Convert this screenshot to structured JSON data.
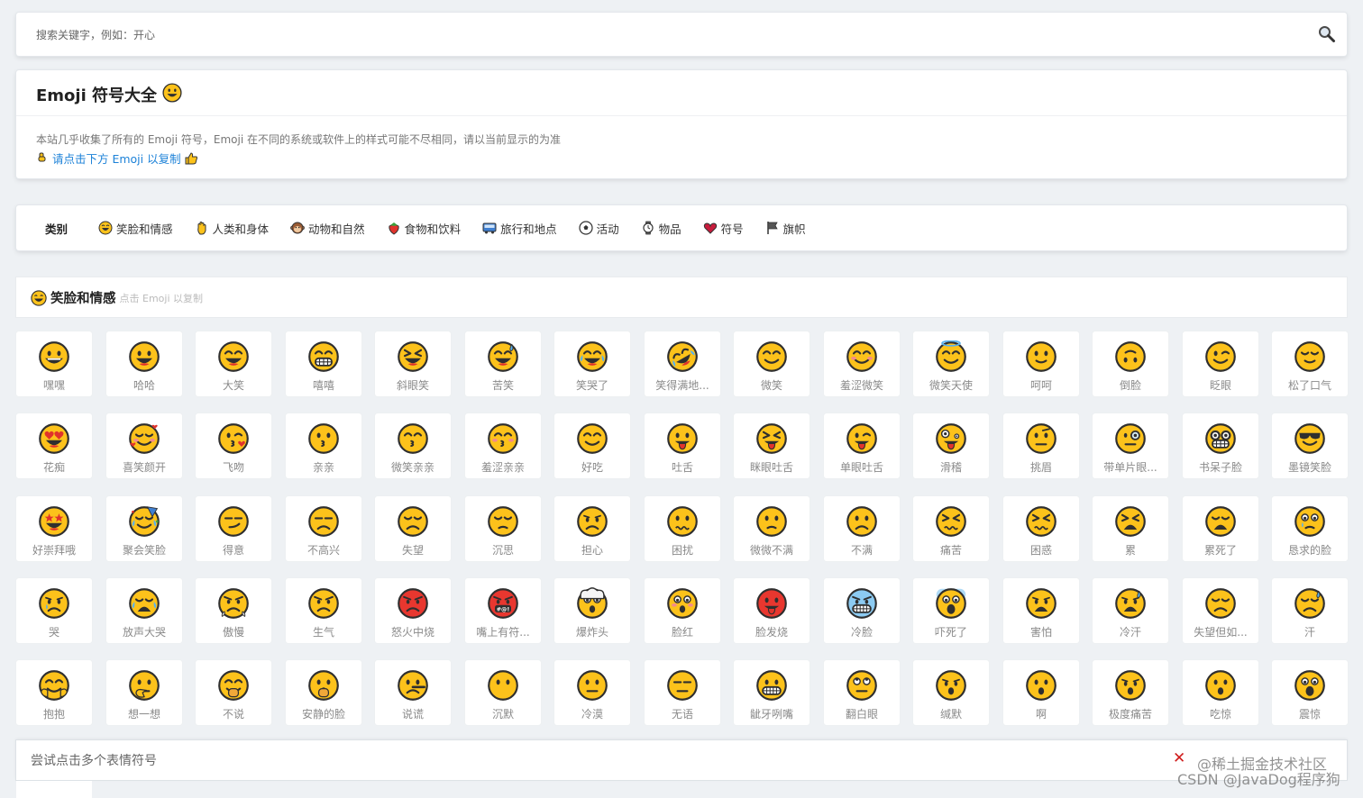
{
  "search": {
    "placeholder": "搜索关键字，例如：开心"
  },
  "header": {
    "title": "Emoji 符号大全",
    "title_emoji": "grinning",
    "description": "本站几乎收集了所有的 Emoji 符号，Emoji 在不同的系统或软件上的样式可能不尽相同，请以当前显示的为准",
    "hint": "请点击下方 Emoji 以复制"
  },
  "categories": {
    "label": "类别",
    "items": [
      {
        "label": "笑脸和情感",
        "icon": "smiley-icon"
      },
      {
        "label": "人类和身体",
        "icon": "hand-icon"
      },
      {
        "label": "动物和自然",
        "icon": "monkey-icon"
      },
      {
        "label": "食物和饮料",
        "icon": "strawberry-icon"
      },
      {
        "label": "旅行和地点",
        "icon": "bus-icon"
      },
      {
        "label": "活动",
        "icon": "soccer-icon"
      },
      {
        "label": "物品",
        "icon": "watch-icon"
      },
      {
        "label": "符号",
        "icon": "heart-icon"
      },
      {
        "label": "旗帜",
        "icon": "flag-icon"
      }
    ]
  },
  "section": {
    "title": "笑脸和情感",
    "subtitle": "点击 Emoji 以复制"
  },
  "emojis": [
    {
      "label": "嘿嘿",
      "f": "grin"
    },
    {
      "label": "哈哈",
      "f": "bigsmile"
    },
    {
      "label": "大笑",
      "f": "laugh"
    },
    {
      "label": "嘻嘻",
      "f": "teeth"
    },
    {
      "label": "斜眼笑",
      "f": "squint"
    },
    {
      "label": "苦笑",
      "f": "sweat"
    },
    {
      "label": "笑哭了",
      "f": "joy"
    },
    {
      "label": "笑得满地...",
      "f": "rofl"
    },
    {
      "label": "微笑",
      "f": "smile"
    },
    {
      "label": "羞涩微笑",
      "f": "blush"
    },
    {
      "label": "微笑天使",
      "f": "angel"
    },
    {
      "label": "呵呵",
      "f": "slight"
    },
    {
      "label": "倒脸",
      "f": "upside"
    },
    {
      "label": "眨眼",
      "f": "wink"
    },
    {
      "label": "松了口气",
      "f": "relieved"
    },
    {
      "label": "花痴",
      "f": "hearteyes"
    },
    {
      "label": "喜笑颜开",
      "f": "hearts"
    },
    {
      "label": "飞吻",
      "f": "kissheart"
    },
    {
      "label": "亲亲",
      "f": "kiss"
    },
    {
      "label": "微笑亲亲",
      "f": "kisssmile"
    },
    {
      "label": "羞涩亲亲",
      "f": "kissblush"
    },
    {
      "label": "好吃",
      "f": "yum"
    },
    {
      "label": "吐舌",
      "f": "tongue"
    },
    {
      "label": "眯眼吐舌",
      "f": "squinttongue"
    },
    {
      "label": "单眼吐舌",
      "f": "winktongue"
    },
    {
      "label": "滑稽",
      "f": "zany"
    },
    {
      "label": "挑眉",
      "f": "raised"
    },
    {
      "label": "带单片眼...",
      "f": "monocle"
    },
    {
      "label": "书呆子脸",
      "f": "nerd"
    },
    {
      "label": "墨镜笑脸",
      "f": "sunglasses"
    },
    {
      "label": "好崇拜哦",
      "f": "stars"
    },
    {
      "label": "聚会笑脸",
      "f": "party"
    },
    {
      "label": "得意",
      "f": "smirk"
    },
    {
      "label": "不高兴",
      "f": "unamused"
    },
    {
      "label": "失望",
      "f": "disappointed"
    },
    {
      "label": "沉思",
      "f": "pensive"
    },
    {
      "label": "担心",
      "f": "worried"
    },
    {
      "label": "困扰",
      "f": "confused"
    },
    {
      "label": "微微不满",
      "f": "slightfrown"
    },
    {
      "label": "不满",
      "f": "frown"
    },
    {
      "label": "痛苦",
      "f": "persevere"
    },
    {
      "label": "困惑",
      "f": "confounded"
    },
    {
      "label": "累",
      "f": "tired"
    },
    {
      "label": "累死了",
      "f": "weary"
    },
    {
      "label": "恳求的脸",
      "f": "pleading"
    },
    {
      "label": "哭",
      "f": "cry"
    },
    {
      "label": "放声大哭",
      "f": "sob"
    },
    {
      "label": "傲慢",
      "f": "triumph"
    },
    {
      "label": "生气",
      "f": "angry"
    },
    {
      "label": "怒火中烧",
      "f": "rage"
    },
    {
      "label": "嘴上有符...",
      "f": "cursing"
    },
    {
      "label": "爆炸头",
      "f": "exploding"
    },
    {
      "label": "脸红",
      "f": "flushed"
    },
    {
      "label": "脸发烧",
      "f": "hot"
    },
    {
      "label": "冷脸",
      "f": "cold"
    },
    {
      "label": "吓死了",
      "f": "scream"
    },
    {
      "label": "害怕",
      "f": "fearful"
    },
    {
      "label": "冷汗",
      "f": "coldsweat"
    },
    {
      "label": "失望但如...",
      "f": "relievedsad"
    },
    {
      "label": "汗",
      "f": "downsweat"
    },
    {
      "label": "抱抱",
      "f": "hug"
    },
    {
      "label": "想一想",
      "f": "thinking"
    },
    {
      "label": "不说",
      "f": "handmouth"
    },
    {
      "label": "安静的脸",
      "f": "shush"
    },
    {
      "label": "说谎",
      "f": "lying"
    },
    {
      "label": "沉默",
      "f": "nomouth"
    },
    {
      "label": "冷漠",
      "f": "neutral"
    },
    {
      "label": "无语",
      "f": "expressionless"
    },
    {
      "label": "龇牙咧嘴",
      "f": "grimace"
    },
    {
      "label": "翻白眼",
      "f": "rolleyes"
    },
    {
      "label": "缄默",
      "f": "hushed"
    },
    {
      "label": "啊",
      "f": "frownopen"
    },
    {
      "label": "极度痛苦",
      "f": "anguished"
    },
    {
      "label": "吃惊",
      "f": "openmouth"
    },
    {
      "label": "震惊",
      "f": "astonished"
    }
  ],
  "bottom": {
    "placeholder": "尝试点击多个表情符号"
  },
  "watermark": {
    "line1": "@稀土掘金技术社区",
    "line2": "CSDN @JavaDog程序狗"
  },
  "colors": {
    "accent": "#1d82d8",
    "face": "#fcc21b",
    "outline": "#2f2f2f",
    "close": "#d01c1c"
  }
}
